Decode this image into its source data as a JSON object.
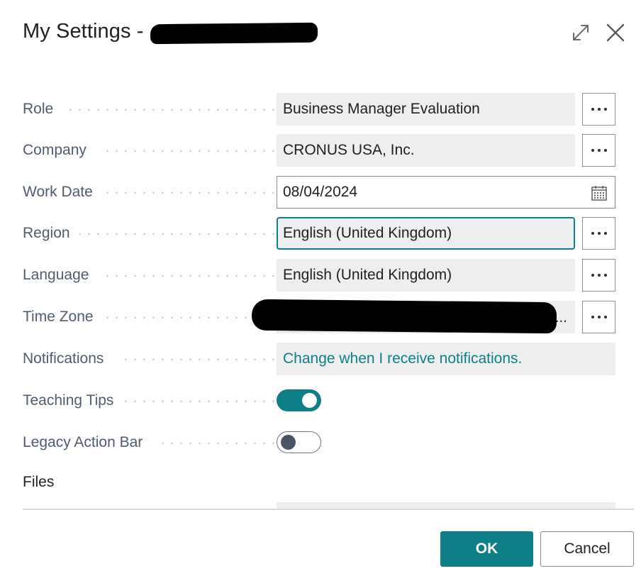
{
  "dialog": {
    "title": "My Settings -",
    "title_redacted": true,
    "header_icons": [
      "expand-icon",
      "close-icon"
    ]
  },
  "fields": [
    {
      "label": "Role",
      "value": "Business Manager Evaluation",
      "type": "lookup"
    },
    {
      "label": "Company",
      "value": "CRONUS USA, Inc.",
      "type": "lookup"
    },
    {
      "label": "Work Date",
      "value": "08/04/2024",
      "type": "date"
    },
    {
      "label": "Region",
      "value": "English (United Kingdom)",
      "type": "lookup",
      "focused": true
    },
    {
      "label": "Language",
      "value": "English (United Kingdom)",
      "type": "lookup"
    },
    {
      "label": "Time Zone",
      "value": "...",
      "type": "lookup",
      "redacted": true
    },
    {
      "label": "Notifications",
      "value": "Change when I receive notifications.",
      "type": "link"
    },
    {
      "label": "Teaching Tips",
      "type": "toggle",
      "checked": true
    },
    {
      "label": "Legacy Action Bar",
      "type": "toggle",
      "checked": false
    }
  ],
  "sections": {
    "files_title": "Files"
  },
  "buttons": {
    "ok": "OK",
    "cancel": "Cancel"
  },
  "colors": {
    "accent": "#0e7f86",
    "field_bg": "#edeef0",
    "label": "#505c6d"
  }
}
